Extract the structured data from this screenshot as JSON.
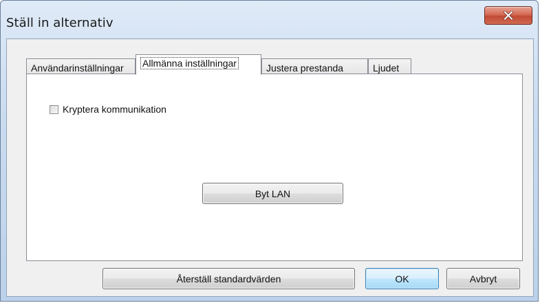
{
  "window": {
    "title": "Ställ in alternativ"
  },
  "tabs": [
    {
      "label": "Användarinställningar",
      "active": false
    },
    {
      "label": "Allmänna inställningar",
      "active": true
    },
    {
      "label": "Justera prestanda",
      "active": false
    },
    {
      "label": "Ljudet",
      "active": false
    }
  ],
  "panel": {
    "encrypt_checkbox": {
      "label": "Kryptera kommunikation",
      "checked": false
    },
    "change_lan_label": "Byt LAN"
  },
  "footer": {
    "restore_defaults_label": "Återställ standardvärden",
    "ok_label": "OK",
    "cancel_label": "Avbryt"
  },
  "icons": {
    "close": "close-icon"
  },
  "colors": {
    "close_button": "#c8503a",
    "frame": "#c9dbef",
    "default_button_border": "#3c7fb1"
  }
}
